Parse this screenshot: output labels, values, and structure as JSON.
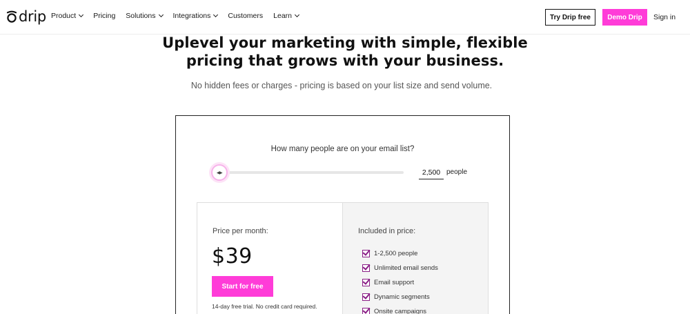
{
  "brand": {
    "logo_text": "drip",
    "accent": "#ff3cd8",
    "check_color": "#8a1e86"
  },
  "nav": {
    "items": [
      {
        "label": "Product",
        "has_dropdown": true
      },
      {
        "label": "Pricing",
        "has_dropdown": false
      },
      {
        "label": "Solutions",
        "has_dropdown": true
      },
      {
        "label": "Integrations",
        "has_dropdown": true
      },
      {
        "label": "Customers",
        "has_dropdown": false
      },
      {
        "label": "Learn",
        "has_dropdown": true
      }
    ],
    "try_label": "Try Drip free",
    "demo_label": "Demo Drip",
    "signin_label": "Sign in"
  },
  "hero": {
    "title_line1": "Uplevel your marketing with simple, flexible",
    "title_line2": "pricing that grows with your business.",
    "subtitle": "No hidden fees or charges - pricing is based on your list size and send volume."
  },
  "calculator": {
    "question": "How many people are on your email list?",
    "slider_icon": "arrows-left-right-icon",
    "slider_fraction": 0,
    "count_value": "2,500",
    "count_unit": "people",
    "price_label": "Price per month:",
    "price": "$39",
    "start_label": "Start for free",
    "trial_note": "14-day free trial. No credit card required.",
    "included_label": "Included in price:",
    "features": [
      "1-2,500 people",
      "Unlimited email sends",
      "Email support",
      "Dynamic segments",
      "Onsite campaigns"
    ]
  }
}
